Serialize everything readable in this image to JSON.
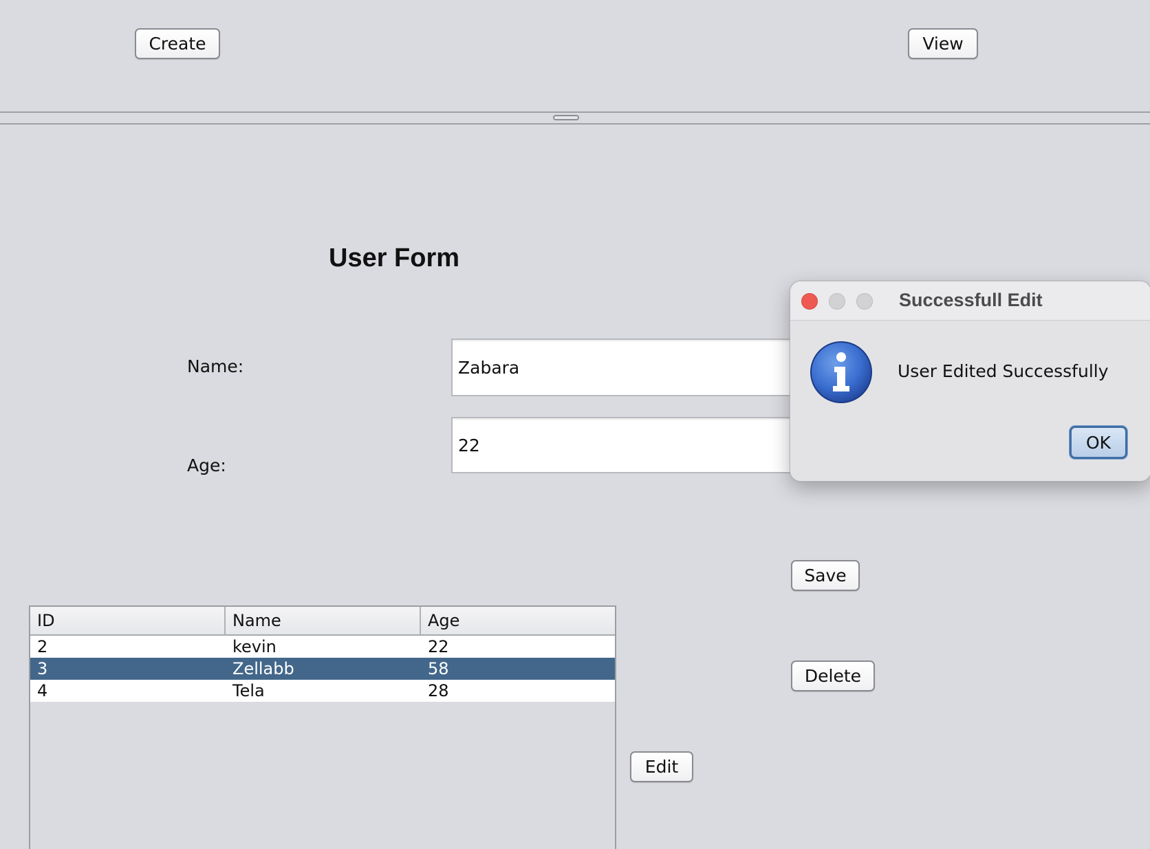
{
  "toolbar": {
    "create_label": "Create",
    "view_label": "View"
  },
  "form": {
    "title": "User Form",
    "name_label": "Name:",
    "name_value": "Zabara",
    "age_label": "Age:",
    "age_value": "22",
    "save_label": "Save",
    "delete_label": "Delete",
    "edit_label": "Edit"
  },
  "table": {
    "columns": [
      "ID",
      "Name",
      "Age"
    ],
    "rows": [
      {
        "id": "2",
        "name": "kevin",
        "age": "22",
        "selected": false
      },
      {
        "id": "3",
        "name": "Zellabb",
        "age": "58",
        "selected": true
      },
      {
        "id": "4",
        "name": "Tela",
        "age": "28",
        "selected": false
      }
    ],
    "selection_color": "#42678a"
  },
  "dialog": {
    "title": "Successfull Edit",
    "message": "User Edited Successfully",
    "ok_label": "OK",
    "icon": "info-icon",
    "close_color": "#ee5a52",
    "inactive_color": "#d0d0d3"
  }
}
